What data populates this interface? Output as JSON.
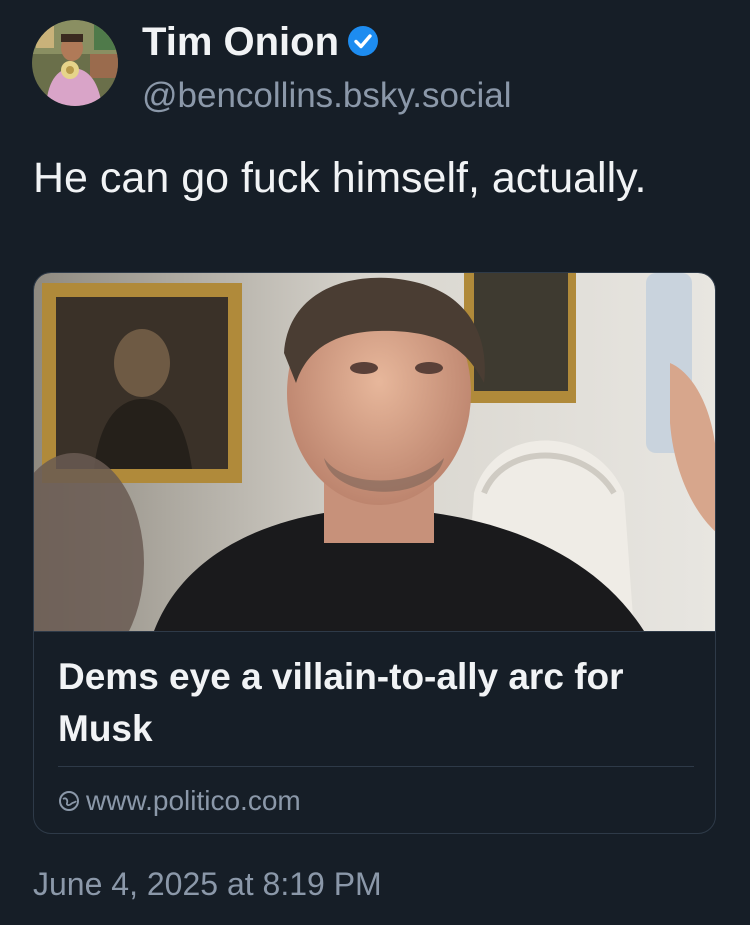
{
  "author": {
    "display_name": "Tim Onion",
    "handle": "@bencollins.bsky.social",
    "verified": true,
    "verified_color": "#1d8cf0"
  },
  "post": {
    "text": "He can go fuck himself, actually.",
    "timestamp": "June 4, 2025 at 8:19 PM"
  },
  "link_card": {
    "title": "Dems eye a villain-to-ally arc for Musk",
    "source_icon": "globe-icon",
    "url": "www.politico.com"
  },
  "colors": {
    "background": "#161e27",
    "text_primary": "#f1f3f5",
    "text_secondary": "#8b98a9",
    "border": "#2e3a48"
  }
}
